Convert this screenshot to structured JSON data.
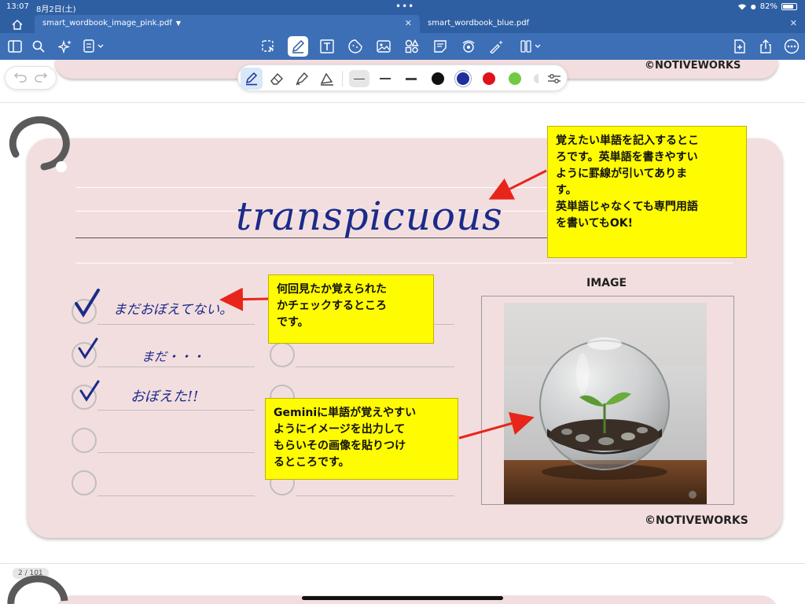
{
  "status": {
    "time": "13:07",
    "date": "8月2日(土)",
    "battery": "82%",
    "battery_level": 0.82
  },
  "tabs": [
    {
      "label": "smart_wordbook_image_pink.pdf",
      "active": true
    },
    {
      "label": "smart_wordbook_blue.pdf",
      "active": false
    }
  ],
  "toolbar": {
    "left_icons": [
      "sidebar-icon",
      "search-icon",
      "ai-sparkle-icon",
      "page-settings-icon"
    ],
    "center_icons": [
      "lasso-icon",
      "pen-icon",
      "text-box-icon",
      "sticker-icon",
      "image-icon",
      "shapes-icon",
      "sticky-note-icon",
      "record-audio-icon",
      "laser-pointer-icon",
      "more-tools-icon"
    ],
    "right_icons": [
      "add-page-icon",
      "share-icon",
      "more-icon"
    ]
  },
  "pen_panel": {
    "tools": [
      "fountain-pen-icon",
      "eraser-icon",
      "highlighter-icon",
      "marker-icon"
    ],
    "colors": [
      "#111111",
      "#1f2f9e",
      "#e0121b",
      "#74c943"
    ],
    "selected_color": "#1f2f9e"
  },
  "card": {
    "word": "transpicuous",
    "check_notes": [
      "まだおぼえてない。",
      "まだ・・・",
      "おぼえた!!"
    ],
    "image_label": "IMAGE",
    "copyright": "©NOTIVEWORKS",
    "prev_copyright": "©NOTIVEWORKS"
  },
  "callouts": {
    "word_area": "覚えたい単語を記入するとこ\nろです。英単語を書きやすい\nように罫線が引いてありま\nす。\n英単語じゃなくても専門用語\nを書いてもOK!",
    "check_area": "何回見たか覚えられた\nかチェックするところ\nです。",
    "image_area": "Geminiに単語が覚えやすい\nようにイメージを出力して\nもらいその画像を貼りつけ\nるところです。"
  },
  "page_indicator": "2 / 101"
}
